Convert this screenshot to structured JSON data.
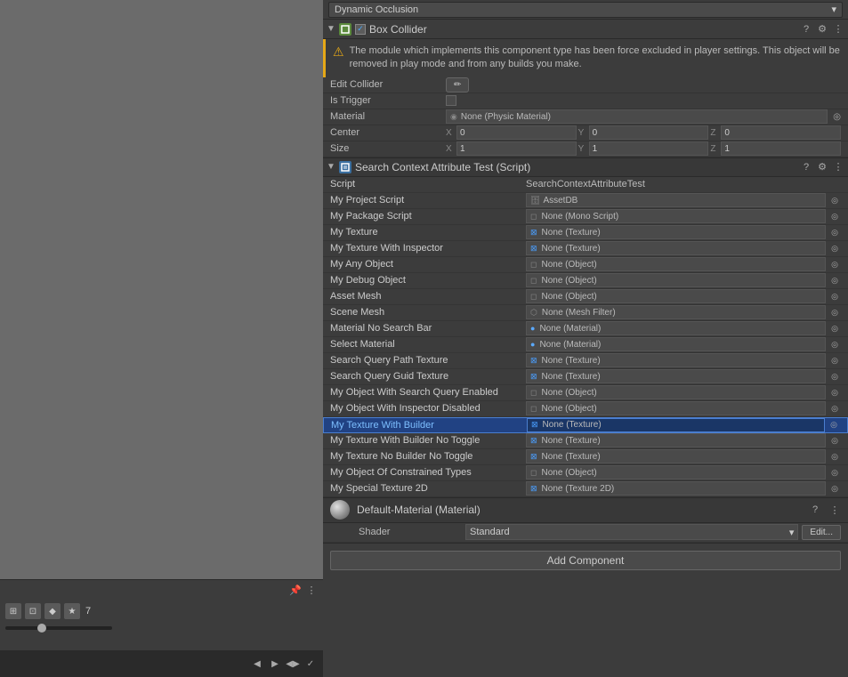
{
  "left_panel": {
    "toolbar": {
      "pin_label": "📌",
      "icons": [
        "⊞",
        "⊡",
        "◆",
        "★"
      ],
      "star_count": "7"
    },
    "status_icons": [
      "◀",
      "▶",
      "◀▶",
      "✓"
    ]
  },
  "dynamic_occlusion": {
    "label": "Dynamic Occlusion"
  },
  "box_collider": {
    "title": "Box Collider",
    "checkbox_checked": true,
    "warning": "The module which implements this component type has been force excluded in player settings. This object will be removed in play mode and from any builds you make.",
    "properties": {
      "edit_collider": "Edit Collider",
      "is_trigger": "Is Trigger",
      "material": "Material",
      "material_value": "None (Physic Material)",
      "center": "Center",
      "center_x": "0",
      "center_y": "0",
      "center_z": "0",
      "size": "Size",
      "size_x": "1",
      "size_y": "1",
      "size_z": "1"
    }
  },
  "script_component": {
    "title": "Search Context Attribute Test (Script)",
    "script_file": "SearchContextAttributeTest",
    "rows": [
      {
        "label": "Script",
        "value": "SearchContextAttributeTest",
        "icon": "script",
        "type": "script"
      },
      {
        "label": "My Project Script",
        "value": "AssetDB",
        "icon": "db",
        "type": "db",
        "highlighted": false,
        "selected": true
      },
      {
        "label": "My Package Script",
        "value": "None (Mono Script)",
        "icon": "script",
        "type": "mono"
      },
      {
        "label": "My Texture",
        "value": "None (Texture)",
        "icon": "texture",
        "type": "texture"
      },
      {
        "label": "My Texture With Inspector",
        "value": "None (Texture)",
        "icon": "texture",
        "type": "texture"
      },
      {
        "label": "My Any Object",
        "value": "None (Object)",
        "icon": "object",
        "type": "object"
      },
      {
        "label": "My Debug Object",
        "value": "None (Object)",
        "icon": "object",
        "type": "object"
      },
      {
        "label": "Asset Mesh",
        "value": "None (Object)",
        "icon": "object",
        "type": "object"
      },
      {
        "label": "Scene Mesh",
        "value": "None (Mesh Filter)",
        "icon": "mesh",
        "type": "mesh"
      },
      {
        "label": "Material No Search Bar",
        "value": "None (Material)",
        "icon": "material-circle",
        "type": "material-circle"
      },
      {
        "label": "Select Material",
        "value": "None (Material)",
        "icon": "material-circle",
        "type": "material-circle"
      },
      {
        "label": "Search Query Path Texture",
        "value": "None (Texture)",
        "icon": "texture",
        "type": "texture"
      },
      {
        "label": "Search Query Guid Texture",
        "value": "None (Texture)",
        "icon": "texture",
        "type": "texture"
      },
      {
        "label": "My Object With Search Query Enabled",
        "value": "None (Object)",
        "icon": "object",
        "type": "object"
      },
      {
        "label": "My Object With Inspector Disabled",
        "value": "None (Object)",
        "icon": "object",
        "type": "object"
      },
      {
        "label": "My Texture With Builder",
        "value": "None (Texture)",
        "icon": "texture",
        "type": "texture",
        "highlighted": true
      },
      {
        "label": "My Texture With Builder No Toggle",
        "value": "None (Texture)",
        "icon": "texture",
        "type": "texture"
      },
      {
        "label": "My Texture No Builder No Toggle",
        "value": "None (Texture)",
        "icon": "texture",
        "type": "texture"
      },
      {
        "label": "My Object Of Constrained Types",
        "value": "None (Object)",
        "icon": "object",
        "type": "object"
      },
      {
        "label": "My Special Texture 2D",
        "value": "None (Texture 2D)",
        "icon": "texture2d",
        "type": "texture2d"
      }
    ]
  },
  "material": {
    "title": "Default-Material (Material)",
    "shader_label": "Shader",
    "shader_value": "Standard",
    "edit_label": "Edit..."
  },
  "add_component": {
    "label": "Add Component"
  },
  "icons": {
    "question": "?",
    "settings": "⚙",
    "menu": "⋮",
    "arrow_down": "▾",
    "arrow_right": "▸",
    "checkmark": "✓",
    "circle_target": "◎",
    "warning": "⚠"
  }
}
